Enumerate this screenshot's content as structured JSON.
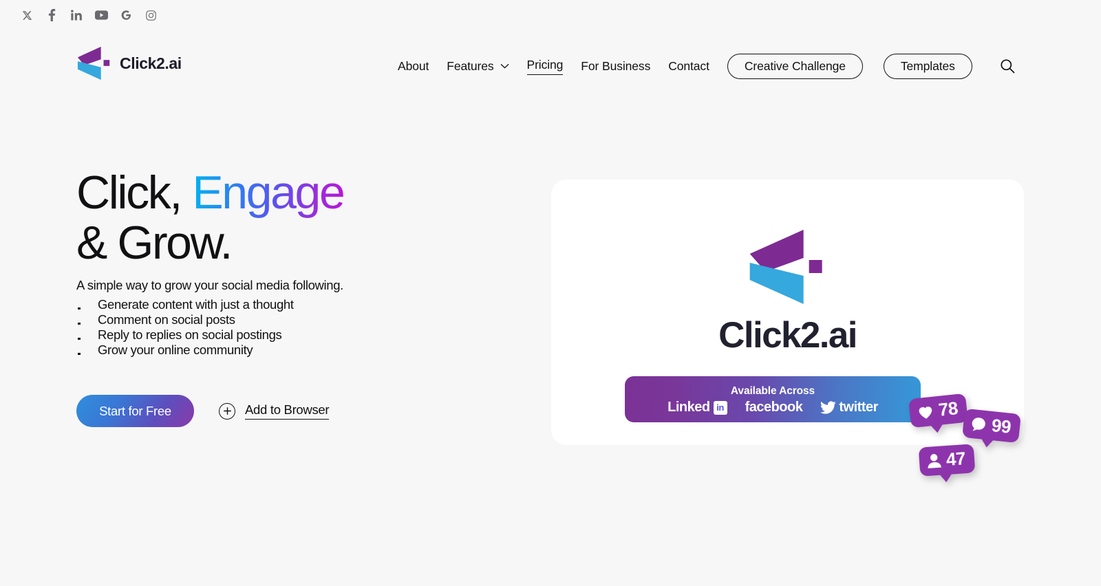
{
  "social_strip": [
    {
      "name": "x-twitter-icon",
      "label": "X"
    },
    {
      "name": "facebook-icon",
      "label": "Facebook"
    },
    {
      "name": "linkedin-icon",
      "label": "LinkedIn"
    },
    {
      "name": "youtube-icon",
      "label": "YouTube"
    },
    {
      "name": "google-icon",
      "label": "Google"
    },
    {
      "name": "instagram-icon",
      "label": "Instagram"
    }
  ],
  "header": {
    "brand_name": "Click2.ai",
    "nav": {
      "about": "About",
      "features": "Features",
      "pricing": "Pricing",
      "for_business": "For Business",
      "contact": "Contact",
      "active_item": "Pricing"
    },
    "buttons": {
      "creative_challenge": "Creative Challenge",
      "templates": "Templates"
    },
    "search_icon": "search-icon"
  },
  "hero": {
    "headline_part1": "Click, ",
    "headline_gradient": "Engage",
    "headline_part2": "& Grow.",
    "subtitle": "A simple way to grow your social media following.",
    "bullets": [
      "Generate content with just a thought",
      "Comment on social posts",
      "Reply to replies on social postings",
      "Grow your online community"
    ],
    "primary_cta": "Start for Free",
    "secondary_cta": "Add to Browser",
    "secondary_cta_icon": "plus-circle-icon"
  },
  "card": {
    "logo_word": "Click2.ai",
    "banner": {
      "title": "Available Across",
      "platforms": [
        {
          "name": "linkedin",
          "label": "Linked",
          "badge": "in"
        },
        {
          "name": "facebook",
          "label": "facebook"
        },
        {
          "name": "twitter",
          "label": "twitter"
        }
      ]
    },
    "badges": [
      {
        "id": "badge-likes",
        "icon": "heart-icon",
        "count": "78"
      },
      {
        "id": "badge-comments",
        "icon": "comment-icon",
        "count": "99"
      },
      {
        "id": "badge-followers",
        "icon": "person-icon",
        "count": "47"
      }
    ]
  },
  "colors": {
    "page_bg": "#f7f7f7",
    "card_bg": "#ffffff",
    "text": "#111113",
    "logo_purple": "#7e2a93",
    "logo_cyan": "#35a8dd",
    "badge_purple": "#8d34ad",
    "gradient_cyan": "#00b5f0",
    "gradient_magenta": "#b915d8",
    "banner_left": "#7b3296",
    "banner_right": "#3598d8"
  }
}
